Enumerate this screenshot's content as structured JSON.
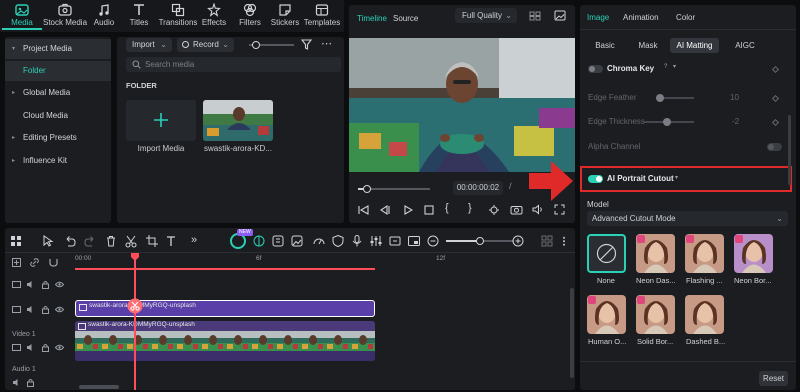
{
  "toolbar": {
    "items": [
      {
        "label": "Media",
        "icon": "media-icon",
        "active": true
      },
      {
        "label": "Stock Media",
        "icon": "stock-media-icon"
      },
      {
        "label": "Audio",
        "icon": "audio-icon"
      },
      {
        "label": "Titles",
        "icon": "titles-icon"
      },
      {
        "label": "Transitions",
        "icon": "transitions-icon"
      },
      {
        "label": "Effects",
        "icon": "effects-icon"
      },
      {
        "label": "Filters",
        "icon": "filters-icon"
      },
      {
        "label": "Stickers",
        "icon": "stickers-icon"
      },
      {
        "label": "Templates",
        "icon": "templates-icon"
      }
    ]
  },
  "sidebar": {
    "items": [
      {
        "label": "Project Media",
        "caret": "▾"
      },
      {
        "label": "Folder"
      },
      {
        "label": "Global Media",
        "caret": "▸"
      },
      {
        "label": "Cloud Media"
      },
      {
        "label": "Editing Presets",
        "caret": "▸"
      },
      {
        "label": "Influence Kit",
        "caret": "▸"
      }
    ]
  },
  "media": {
    "import_label": "Import",
    "record_label": "Record",
    "search_placeholder": "Search media",
    "folder_heading": "FOLDER",
    "import_tile_label": "Import Media",
    "clip_label": "swastik-arora-KD..."
  },
  "preview": {
    "tabs": [
      "Timeline",
      "Source"
    ],
    "quality": "Full Quality",
    "timecode": "00:00:00:02",
    "progress": 0.12
  },
  "properties": {
    "top_tabs": [
      "Image",
      "Animation",
      "Color"
    ],
    "sub_tabs": [
      "Basic",
      "Mask",
      "AI Matting",
      "AIGC"
    ],
    "chroma_key": "Chroma Key",
    "edge_feather": {
      "label": "Edge Feather",
      "value": "10",
      "level": 0.1
    },
    "edge_thickness": {
      "label": "Edge Thickness",
      "value": "-2",
      "level": 0.45
    },
    "alpha_channel": "Alpha Channel",
    "ai_portrait_cutout": "AI Portrait Cutout",
    "model_label": "Model",
    "model_value": "Advanced Cutout Mode",
    "effects": [
      {
        "label": "None"
      },
      {
        "label": "Neon Das..."
      },
      {
        "label": "Flashing ..."
      },
      {
        "label": "Neon Bor..."
      },
      {
        "label": "Human O..."
      },
      {
        "label": "Solid Bor..."
      },
      {
        "label": "Dashed B..."
      }
    ],
    "reset_label": "Reset"
  },
  "timeline": {
    "ruler": [
      "00:00",
      "6f",
      "12f"
    ],
    "clips": [
      "swastik-arora-KDMMyRGQ-unsplash",
      "swastik-arora-KDMMyRGQ-unsplash"
    ],
    "tracks": [
      "Video 1",
      "Audio 1"
    ],
    "badge": "NEW"
  },
  "colors": {
    "accent": "#2ad1b7",
    "clip_purple": "#5b3fa8",
    "playhead": "#ff4d5a",
    "highlight_red": "#e02a2a"
  }
}
